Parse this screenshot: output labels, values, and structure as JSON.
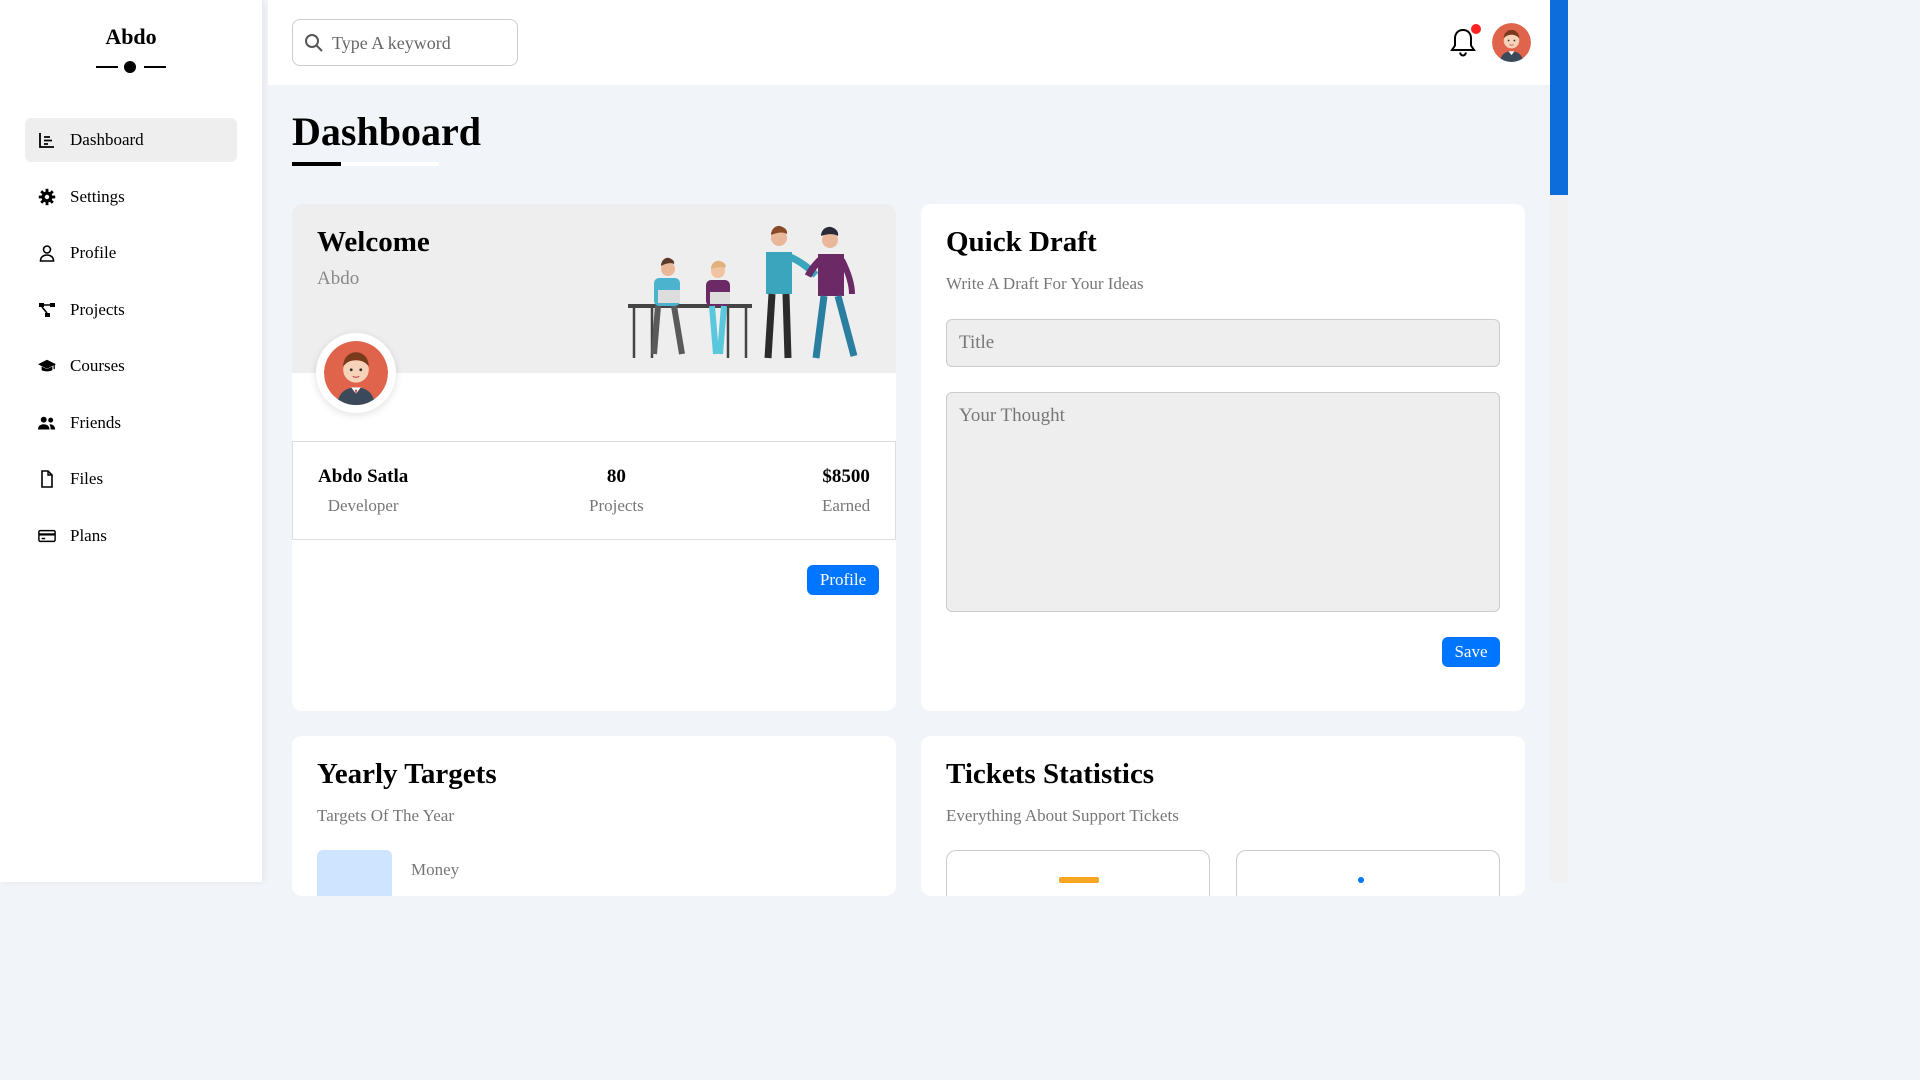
{
  "brand": {
    "name": "Abdo"
  },
  "sidebar": {
    "items": [
      {
        "label": "Dashboard",
        "icon": "chart-icon",
        "active": true
      },
      {
        "label": "Settings",
        "icon": "gear-icon"
      },
      {
        "label": "Profile",
        "icon": "user-icon"
      },
      {
        "label": "Projects",
        "icon": "diagram-icon"
      },
      {
        "label": "Courses",
        "icon": "graduation-cap-icon"
      },
      {
        "label": "Friends",
        "icon": "users-icon"
      },
      {
        "label": "Files",
        "icon": "file-icon"
      },
      {
        "label": "Plans",
        "icon": "credit-card-icon"
      }
    ]
  },
  "header": {
    "search_placeholder": "Type A keyword",
    "notification_dot_color": "#ff2222"
  },
  "page": {
    "title": "Dashboard"
  },
  "welcome": {
    "title": "Welcome",
    "subtitle": "Abdo",
    "stats": [
      {
        "value": "Abdo Satla",
        "label": "Developer"
      },
      {
        "value": "80",
        "label": "Projects"
      },
      {
        "value": "$8500",
        "label": "Earned"
      }
    ],
    "button": "Profile"
  },
  "draft": {
    "title": "Quick Draft",
    "subtitle": "Write A Draft For Your Ideas",
    "title_placeholder": "Title",
    "thought_placeholder": "Your Thought",
    "button": "Save"
  },
  "targets": {
    "title": "Yearly Targets",
    "subtitle": "Targets Of The Year",
    "first_label": "Money"
  },
  "tickets": {
    "title": "Tickets Statistics",
    "subtitle": "Everything About Support Tickets"
  },
  "colors": {
    "accent": "#0075ff",
    "scroll": "#0d6ddb"
  }
}
